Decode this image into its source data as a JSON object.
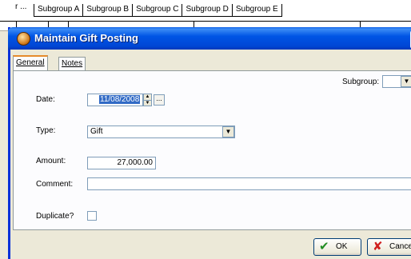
{
  "background": {
    "truncated_label": "r ...",
    "tabs": [
      "Subgroup A",
      "Subgroup B",
      "Subgroup C",
      "Subgroup D",
      "Subgroup E"
    ]
  },
  "dialog": {
    "title": "Maintain Gift Posting",
    "close_glyph": "X",
    "tabs": {
      "general": "General",
      "notes": "Notes"
    },
    "subgroup": {
      "label": "Subgroup:",
      "value": ""
    },
    "date": {
      "label": "Date:",
      "value": "11/08/2008",
      "picker_label": "..."
    },
    "type": {
      "label": "Type:",
      "value": "Gift"
    },
    "amount": {
      "label": "Amount:",
      "value": "27,000.00"
    },
    "comment": {
      "label": "Comment:",
      "value": ""
    },
    "duplicate": {
      "label": "Duplicate?",
      "checked": false
    },
    "buttons": {
      "ok": "OK",
      "cancel": "Cancel"
    }
  },
  "icons": {
    "app": "gift-app-icon",
    "ok": "checkmark-icon",
    "cancel": "x-icon",
    "dropdown": "chevron-down-icon"
  },
  "colors": {
    "titlebar": "#0055e5",
    "selection": "#316ac5",
    "ok_icon": "#218c21",
    "cancel_icon": "#d02020",
    "active_tab_accent": "#e68b2c"
  }
}
